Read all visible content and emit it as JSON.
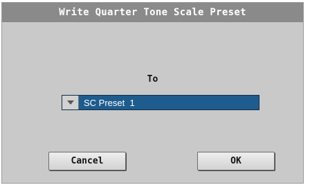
{
  "dialog": {
    "title": "Write Quarter Tone Scale Preset",
    "to_label": "To",
    "preset_select": {
      "value": "SC Preset  1",
      "arrow_icon": "triangle-down-icon"
    },
    "buttons": {
      "cancel_label": "Cancel",
      "ok_label": "OK"
    }
  },
  "colors": {
    "title_bar": "#8a8a8a",
    "dialog_bg": "#c9c9c9",
    "select_bg": "#1f5c8e"
  }
}
